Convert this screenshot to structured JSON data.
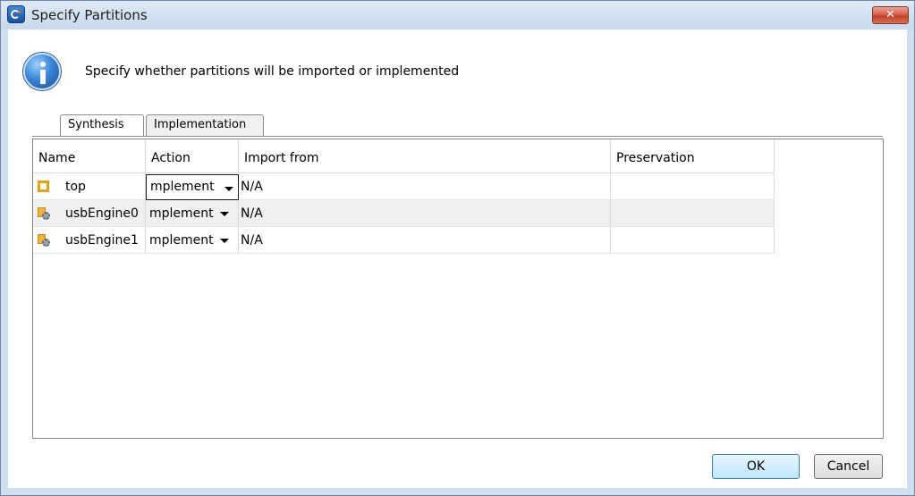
{
  "window": {
    "title": "Specify Partitions",
    "close_label": "✕",
    "colors": {
      "frame": "#cfdff0",
      "close_button": "#c9452f"
    }
  },
  "header": {
    "message": "Specify whether partitions will be imported or implemented"
  },
  "tabs": [
    {
      "label": "Synthesis",
      "active": true
    },
    {
      "label": "Implementation",
      "active": false
    }
  ],
  "table": {
    "columns": [
      "Name",
      "Action",
      "Import from",
      "Preservation"
    ],
    "rows": [
      {
        "name": "top",
        "action": "mplement",
        "import_from": "N/A",
        "preservation": ""
      },
      {
        "name": "usbEngine0",
        "action": "mplement",
        "import_from": "N/A",
        "preservation": ""
      },
      {
        "name": "usbEngine1",
        "action": "mplement",
        "import_from": "N/A",
        "preservation": ""
      }
    ]
  },
  "buttons": {
    "ok": "OK",
    "cancel": "Cancel"
  }
}
